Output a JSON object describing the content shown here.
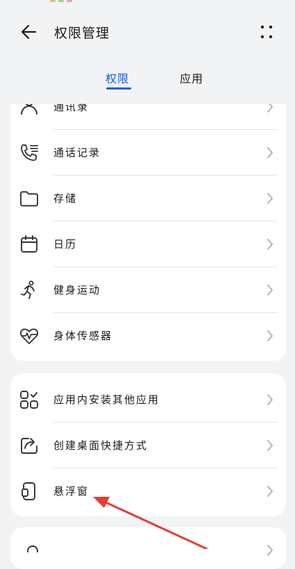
{
  "header": {
    "title": "权限管理",
    "back_icon": "arrow-left-icon",
    "more_icon": "more-vertical-dots-icon"
  },
  "tabs": [
    {
      "label": "权限",
      "selected": true
    },
    {
      "label": "应用",
      "selected": false
    }
  ],
  "colors": {
    "accent": "#0a59f7",
    "arrow_annotation": "#e83a30"
  },
  "permission_group_1": [
    {
      "label": "通讯录",
      "icon": "contacts-icon"
    },
    {
      "label": "通话记录",
      "icon": "call-log-icon"
    },
    {
      "label": "存储",
      "icon": "folder-icon"
    },
    {
      "label": "日历",
      "icon": "calendar-icon"
    },
    {
      "label": "健身运动",
      "icon": "running-icon"
    },
    {
      "label": "身体传感器",
      "icon": "heart-rate-icon"
    }
  ],
  "permission_group_2": [
    {
      "label": "应用内安装其他应用",
      "icon": "apps-grid-icon"
    },
    {
      "label": "创建桌面快捷方式",
      "icon": "shortcut-icon"
    },
    {
      "label": "悬浮窗",
      "icon": "floating-window-icon"
    }
  ]
}
